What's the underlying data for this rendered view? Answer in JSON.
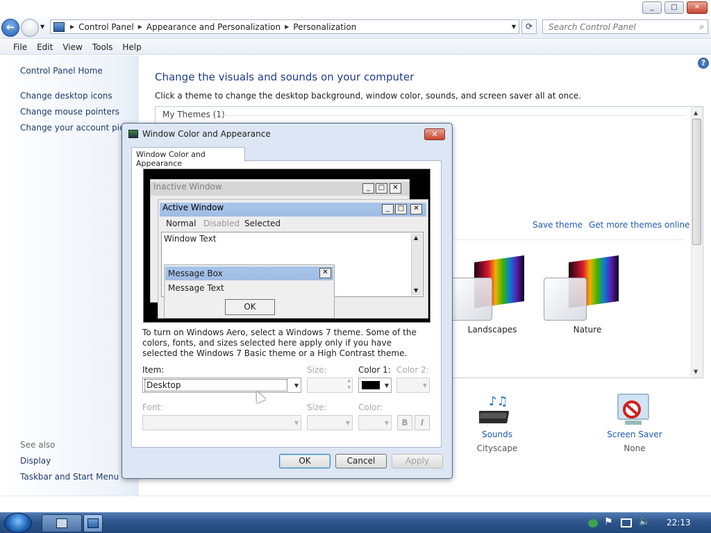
{
  "window": {
    "minimize": "_",
    "maximize": "□",
    "close": "✕"
  },
  "address": {
    "crumbs": [
      "Control Panel",
      "Appearance and Personalization",
      "Personalization"
    ],
    "search_placeholder": "Search Control Panel"
  },
  "menubar": {
    "items": [
      "File",
      "Edit",
      "View",
      "Tools",
      "Help"
    ]
  },
  "sidebar": {
    "home": "Control Panel Home",
    "links": [
      "Change desktop icons",
      "Change mouse pointers",
      "Change your account picture"
    ],
    "see_also_label": "See also",
    "see_also": [
      "Display",
      "Taskbar and Start Menu"
    ]
  },
  "main": {
    "heading": "Change the visuals and sounds on your computer",
    "subtext": "Click a theme to change the desktop background, window color, sounds, and screen saver all at once.",
    "my_themes": "My Themes (1)",
    "save_theme": "Save theme",
    "get_more": "Get more themes online",
    "themes": [
      {
        "name": "Landscapes"
      },
      {
        "name": "Nature"
      }
    ],
    "sounds_label": "Sounds",
    "sounds_value": "Cityscape",
    "screensaver_label": "Screen Saver",
    "screensaver_value": "None"
  },
  "dialog": {
    "title": "Window Color and Appearance",
    "tab": "Window Color and Appearance",
    "preview": {
      "inactive_window": "Inactive Window",
      "active_window": "Active Window",
      "menu_normal": "Normal",
      "menu_disabled": "Disabled",
      "menu_selected": "Selected",
      "window_text": "Window Text",
      "message_box": "Message Box",
      "message_text": "Message Text",
      "ok": "OK"
    },
    "aero_text": "To turn on Windows Aero, select a Windows 7 theme.  Some of the colors, fonts, and sizes selected here apply only if you have selected the Windows 7 Basic theme or a High Contrast theme.",
    "item_label": "Item:",
    "item_value": "Desktop",
    "size_label": "Size:",
    "color1_label": "Color 1:",
    "color1_value": "#000000",
    "color2_label": "Color 2:",
    "font_label": "Font:",
    "font_size_label": "Size:",
    "font_color_label": "Color:",
    "bold": "B",
    "italic": "I",
    "ok_button": "OK",
    "cancel_button": "Cancel",
    "apply_button": "Apply"
  },
  "taskbar": {
    "clock": "22:13"
  },
  "colors": {
    "link": "#1e5ab4",
    "heading": "#1e3c8c",
    "taskbar": "#2d558c"
  }
}
